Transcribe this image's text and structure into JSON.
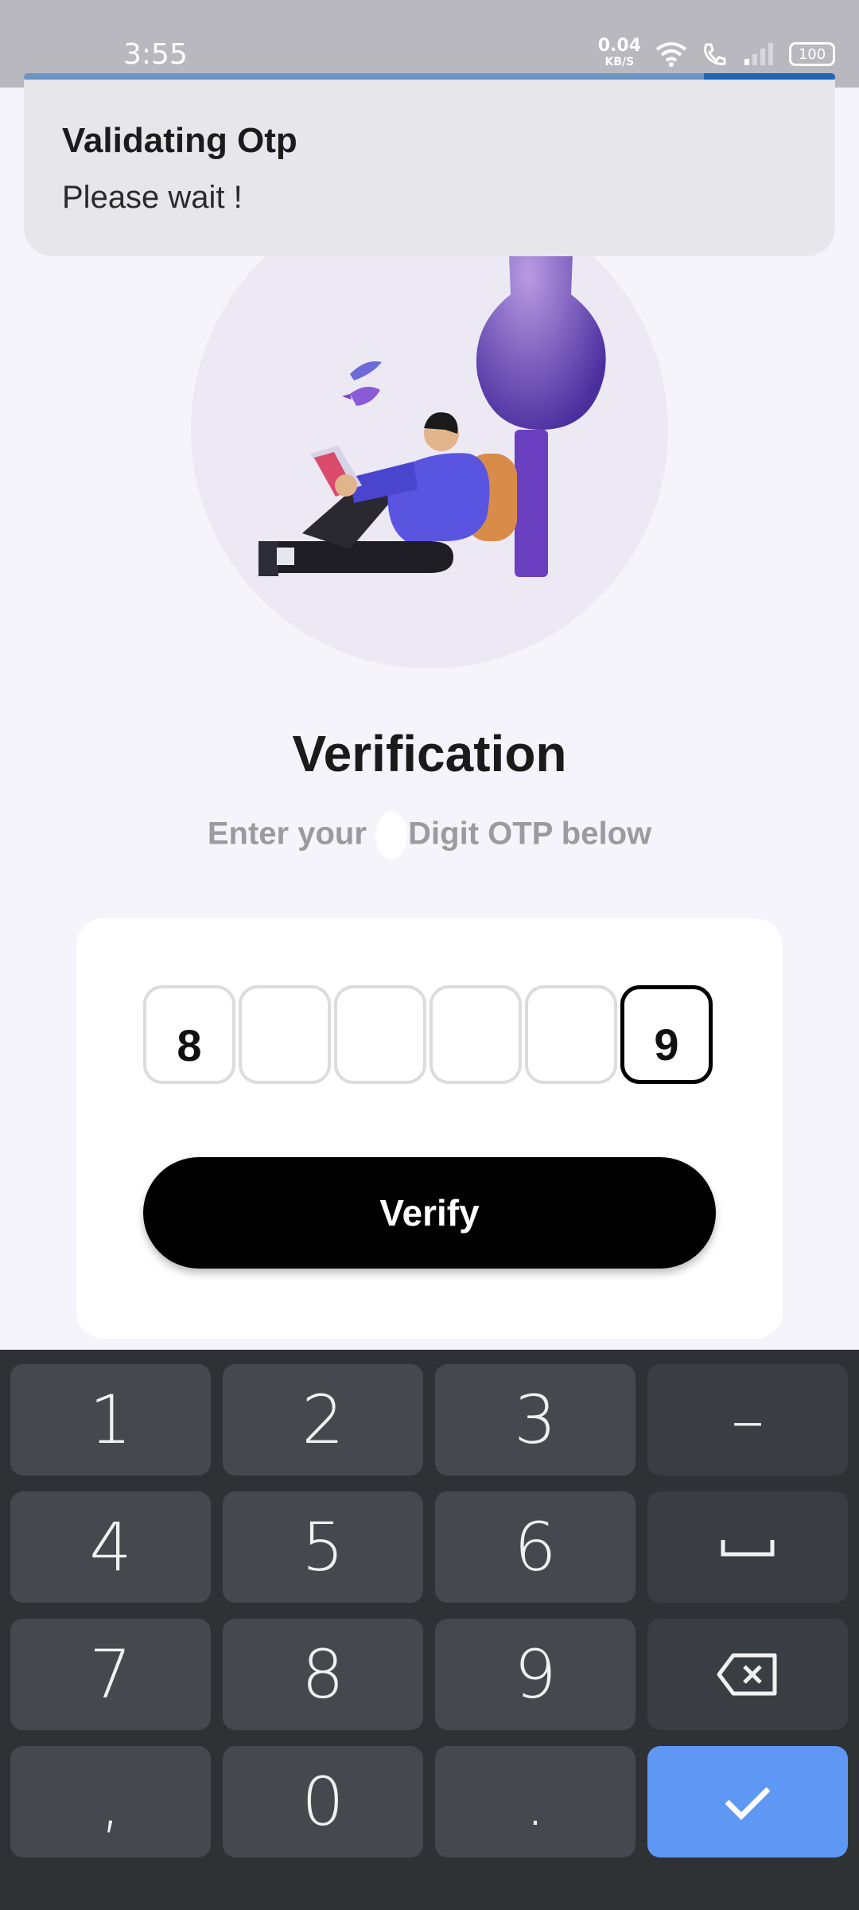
{
  "status_bar": {
    "time": "3:55",
    "net_speed": "0.04",
    "net_unit": "KB/S",
    "battery": "100"
  },
  "toast": {
    "title": "Validating Otp",
    "message": "Please wait !"
  },
  "screen": {
    "title": "Verification",
    "subtitle_prefix": "Enter your",
    "subtitle_suffix": "Digit OTP below"
  },
  "otp": {
    "digits": [
      "8",
      "",
      "",
      "",
      "",
      "9"
    ]
  },
  "verify_button": {
    "label": "Verify"
  },
  "keyboard": {
    "keys": [
      "1",
      "2",
      "3",
      "–",
      "4",
      "5",
      "6",
      "␣",
      "7",
      "8",
      "9",
      "⌫",
      ",",
      "0",
      ".",
      "✓"
    ]
  },
  "colors": {
    "accent_keyboard_done": "#5f97f4",
    "primary_button": "#000000",
    "background": "#f5f4fa"
  }
}
